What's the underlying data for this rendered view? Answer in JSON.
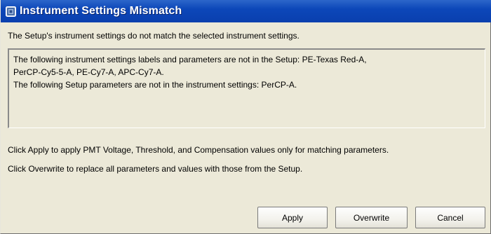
{
  "window": {
    "title": "Instrument Settings Mismatch",
    "title_icon": "app-window-icon",
    "titlebar_color": "#0c47b9"
  },
  "dialog": {
    "summary": "The Setup's instrument settings do not match the selected instrument settings.",
    "details": {
      "line1": "The following instrument settings labels and parameters are not in the Setup: PE-Texas Red-A,",
      "line2": "PerCP-Cy5-5-A, PE-Cy7-A, APC-Cy7-A.",
      "line3": "The following Setup parameters are not in the instrument settings: PerCP-A."
    },
    "apply_hint": "Click Apply to apply PMT Voltage, Threshold, and Compensation values only for matching parameters.",
    "overwrite_hint": "Click Overwrite to replace all parameters and values with those from the Setup."
  },
  "buttons": {
    "apply": "Apply",
    "overwrite": "Overwrite",
    "cancel": "Cancel"
  }
}
